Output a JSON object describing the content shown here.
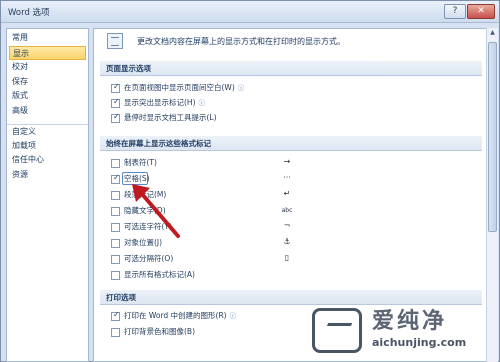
{
  "window": {
    "title": "Word 选项",
    "help_icon": "question-mark",
    "close_icon": "close-x"
  },
  "sidebar": {
    "items": [
      {
        "label": "常用"
      },
      {
        "label": "显示",
        "selected": true
      },
      {
        "label": "校对"
      },
      {
        "label": "保存"
      },
      {
        "label": "版式"
      },
      {
        "label": "高级"
      },
      {
        "label": "自定义"
      },
      {
        "label": "加载项"
      },
      {
        "label": "信任中心"
      },
      {
        "label": "资源"
      }
    ]
  },
  "header": {
    "text": "更改文档内容在屏幕上的显示方式和在打印时的显示方式。"
  },
  "sections": {
    "page_display": {
      "title": "页面显示选项",
      "options": [
        {
          "label": "在页面视图中显示页面间空白(W)",
          "checked": true,
          "info": "ⓘ"
        },
        {
          "label": "显示突出显示标记(H)",
          "checked": true,
          "info": "ⓘ"
        },
        {
          "label": "悬停时显示文档工具提示(L)",
          "checked": true,
          "info": ""
        }
      ]
    },
    "formatting_marks": {
      "title": "始终在屏幕上显示这些格式标记",
      "options": [
        {
          "label": "制表符(T)",
          "checked": false,
          "symbol": "→"
        },
        {
          "label": "空格(S)",
          "checked": true,
          "symbol": "···"
        },
        {
          "label": "段落标记(M)",
          "checked": false,
          "symbol": "↵"
        },
        {
          "label": "隐藏文字(D)",
          "checked": false,
          "symbol": "abc"
        },
        {
          "label": "可选连字符(Y)",
          "checked": false,
          "symbol": "¬"
        },
        {
          "label": "对象位置(J)",
          "checked": false,
          "symbol": "⚓"
        },
        {
          "label": "可选分隔符(O)",
          "checked": false,
          "symbol": "▯"
        },
        {
          "label": "显示所有格式标记(A)",
          "checked": false,
          "symbol": ""
        }
      ]
    },
    "print": {
      "title": "打印选项",
      "options": [
        {
          "label": "打印在 Word 中创建的图形(R)",
          "checked": true,
          "info": "ⓘ"
        },
        {
          "label": "打印背景色和图像(B)",
          "checked": false,
          "info": ""
        }
      ]
    }
  },
  "watermark": {
    "brand": "爱纯净",
    "url": "aichunjing.com"
  },
  "colors": {
    "accent": "#fbd46b",
    "arrow": "#c0191f",
    "section_bg": "#dde6f2"
  }
}
